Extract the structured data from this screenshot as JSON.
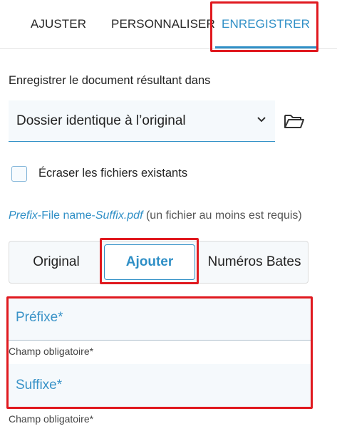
{
  "tabs": [
    {
      "label": "AJUSTER",
      "active": false
    },
    {
      "label": "PERSONNALISER",
      "active": false
    },
    {
      "label": "ENREGISTRER",
      "active": true
    }
  ],
  "save": {
    "label": "Enregistrer le document résultant dans",
    "folder_option": "Dossier identique à l’original",
    "overwrite_label": "Écraser les fichiers existants",
    "overwrite_checked": false
  },
  "pattern": {
    "prefix": "Prefix",
    "middle": "-File name-",
    "suffix": "Suffix.pdf",
    "note": " (un fichier au moins est requis)"
  },
  "modes": {
    "options": [
      "Original",
      "Ajouter",
      "Numéros Bates"
    ],
    "selected": "Ajouter"
  },
  "fields": {
    "prefix_placeholder": "Préfixe*",
    "prefix_help": "Champ obligatoire*",
    "suffix_placeholder": "Suffixe*",
    "suffix_help": "Champ obligatoire*"
  },
  "colors": {
    "accent": "#2f8fc6",
    "highlight": "#e0191f"
  },
  "icons": {
    "dropdown": "chevron-down-icon",
    "folder": "folder-open-icon"
  }
}
